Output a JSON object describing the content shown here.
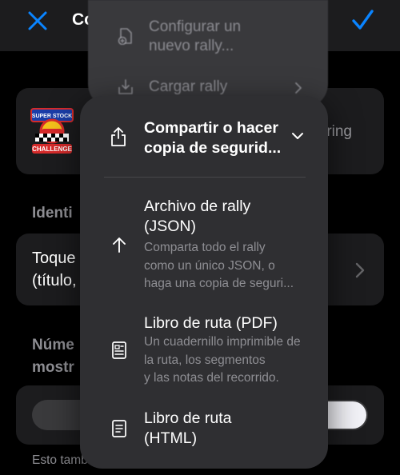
{
  "navbar": {
    "title": "Co",
    "close_icon": "close-x-icon",
    "confirm_icon": "checkmark-icon",
    "accent": "#0a84ff"
  },
  "rally_card": {
    "logo_lines": [
      "SUPER STOCK CLASSIC",
      "CHALLENGE"
    ],
    "side_text": "ring"
  },
  "sections": {
    "identity": "Identi",
    "title_line1": "Toque",
    "title_line2": "(título,",
    "number_line1": "Núme",
    "number_line2": "mostr",
    "footer": "Esto tamb                                                es de"
  },
  "back_menu": {
    "items": [
      {
        "icon": "new-document-icon",
        "label_line1": "Configurar un",
        "label_line2": "nuevo rally..."
      },
      {
        "icon": "download-tray-icon",
        "label": "Cargar rally"
      }
    ]
  },
  "front_menu": {
    "header": {
      "icon": "share-icon",
      "line1": "Compartir o hacer",
      "line2": "copia de segurid..."
    },
    "items": [
      {
        "icon": "arrow-up-icon",
        "label_line1": "Archivo de rally",
        "label_line2": "(JSON)",
        "sub": [
          "Comparta todo el rally",
          "como un único JSON, o",
          "haga una copia de seguri..."
        ]
      },
      {
        "icon": "document-image-icon",
        "label_line1": "Libro de ruta (PDF)",
        "sub": [
          "Un cuadernillo imprimible de",
          "la ruta, los segmentos",
          "y las notas del recorrido."
        ]
      },
      {
        "icon": "document-text-icon",
        "label_line1": "Libro de ruta",
        "label_line2": "(HTML)"
      }
    ]
  }
}
